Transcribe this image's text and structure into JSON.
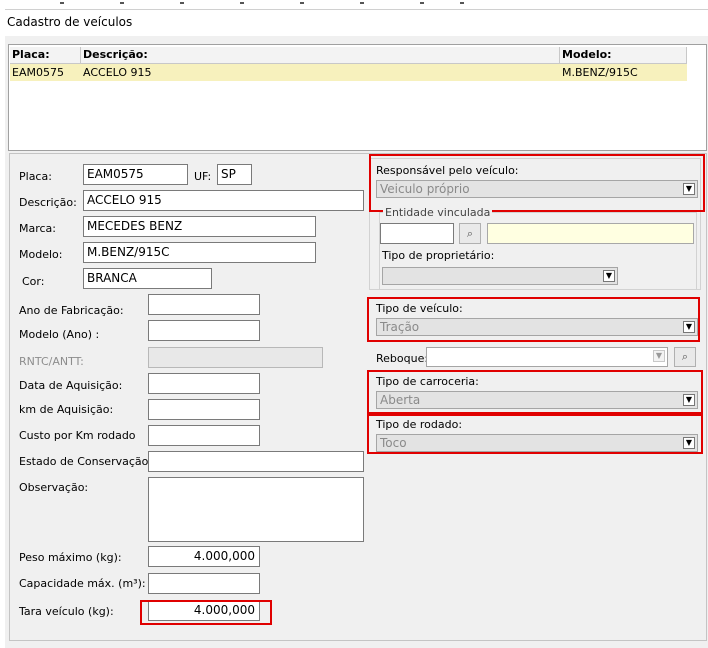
{
  "window": {
    "title": "Cadastro de veículos"
  },
  "grid": {
    "columns": [
      "Placa:",
      "Descrição:",
      "Modelo:"
    ],
    "rows": [
      {
        "placa": "EAM0575",
        "descricao": "ACCELO 915",
        "modelo": "M.BENZ/915C"
      }
    ]
  },
  "form": {
    "placa": {
      "label": "Placa:",
      "value": "EAM0575"
    },
    "uf": {
      "label": "UF:",
      "value": "SP"
    },
    "descricao": {
      "label": "Descrição:",
      "value": "ACCELO 915"
    },
    "marca": {
      "label": "Marca:",
      "value": "MECEDES BENZ"
    },
    "modelo": {
      "label": "Modelo:",
      "value": "M.BENZ/915C"
    },
    "cor": {
      "label": "Cor:",
      "value": "BRANCA"
    },
    "ano_fabricacao": {
      "label": "Ano de Fabricação:",
      "value": ""
    },
    "modelo_ano": {
      "label": "Modelo (Ano) :",
      "value": ""
    },
    "rntc": {
      "label": "RNTC/ANTT:",
      "value": ""
    },
    "data_aquisicao": {
      "label": "Data de Aquisição:",
      "value": ""
    },
    "km_aquisicao": {
      "label": "km de Aquisição:",
      "value": ""
    },
    "custo_km": {
      "label": "Custo por Km rodado",
      "value": ""
    },
    "estado_conservacao": {
      "label": "Estado de Conservação:",
      "value": ""
    },
    "observacao": {
      "label": "Observação:",
      "value": ""
    },
    "peso_maximo": {
      "label": "Peso máximo (kg):",
      "value": "4.000,000"
    },
    "capacidade": {
      "label": "Capacidade máx. (m³):",
      "value": ""
    },
    "tara": {
      "label": "Tara veículo (kg):",
      "value": "4.000,000"
    }
  },
  "right": {
    "responsavel": {
      "label": "Responsável pelo veículo:",
      "value": "Veiculo próprio"
    },
    "entidade": {
      "label": "Entidade vinculada",
      "code": "",
      "name": ""
    },
    "tipo_proprietario": {
      "label": "Tipo de proprietário:",
      "value": ""
    },
    "tipo_veiculo": {
      "label": "Tipo de veículo:",
      "value": "Tração"
    },
    "reboque": {
      "label": "Reboque:",
      "value": ""
    },
    "tipo_carroceria": {
      "label": "Tipo de carroceria:",
      "value": "Aberta"
    },
    "tipo_rodado": {
      "label": "Tipo de rodado:",
      "value": "Toco"
    }
  },
  "colors": {
    "highlight": "#e00000",
    "selected_row": "#f7f1bd",
    "lookup_field": "#ffffe1"
  },
  "icons": {
    "search": "binoculars-icon",
    "dropdown": "chevron-down-icon"
  }
}
